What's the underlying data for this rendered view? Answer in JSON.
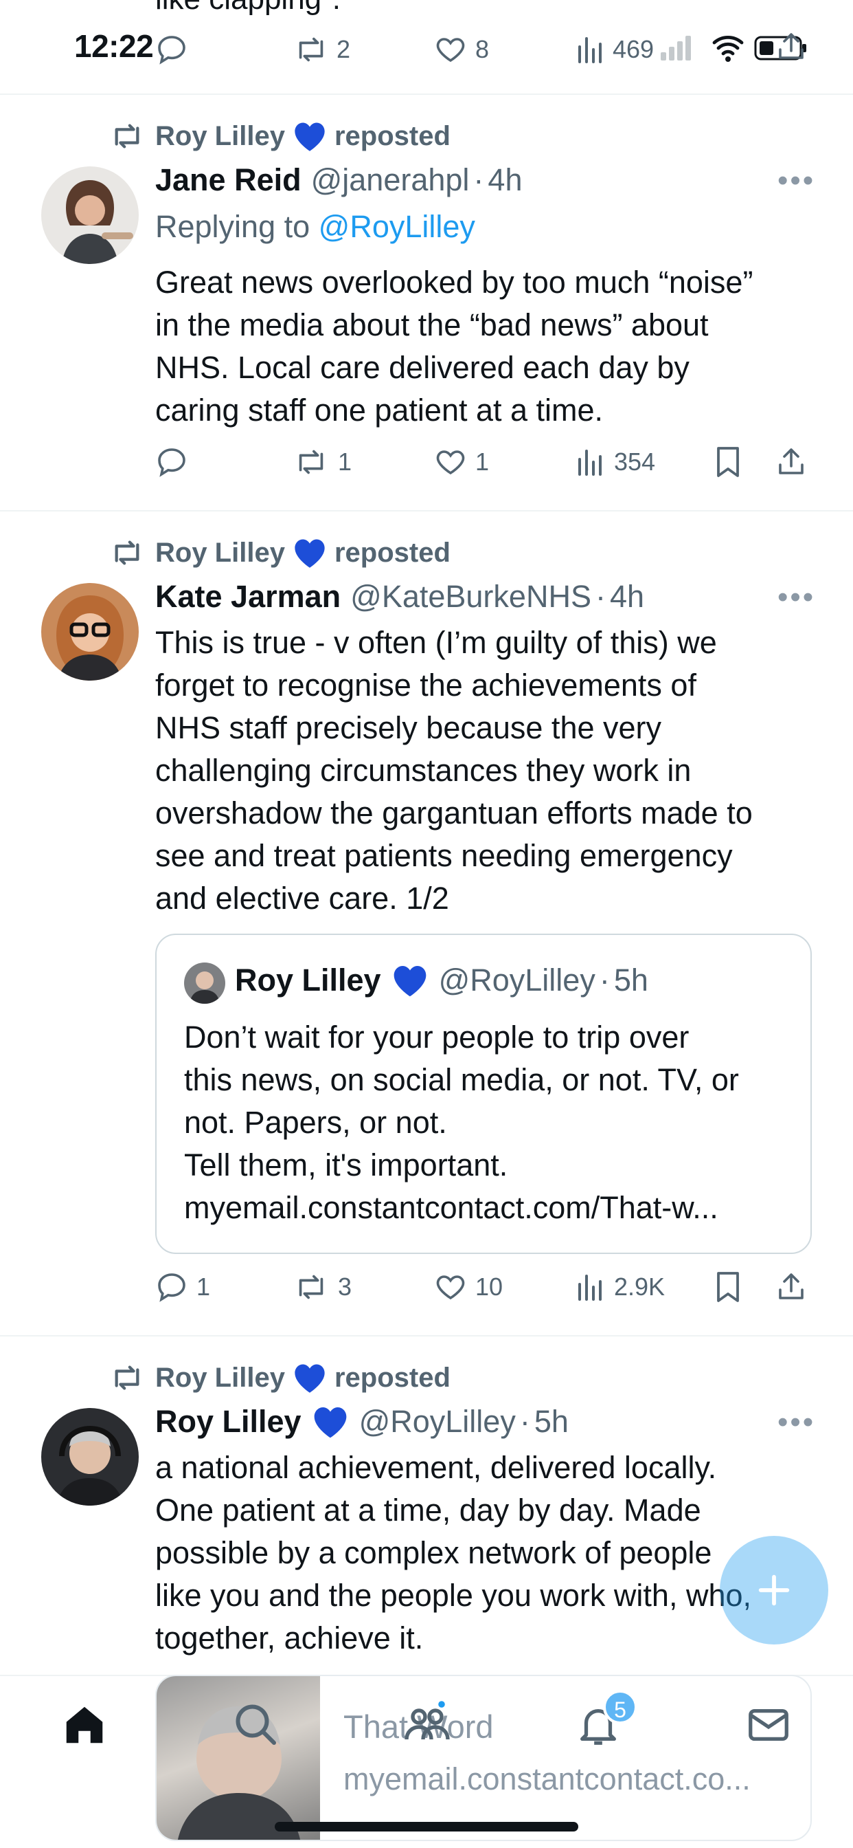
{
  "status_bar": {
    "time": "12:22",
    "cutoff_text": "like clapping\"."
  },
  "top_partial_actions": {
    "reposts": "2",
    "likes": "8",
    "views": "469"
  },
  "colors": {
    "accent": "#1d9bf0",
    "muted": "#536471",
    "heart": "#1d4ed8"
  },
  "feed": [
    {
      "reposted_by": "Roy Lilley",
      "reposted_label": "reposted",
      "name": "Jane Reid",
      "handle": "@janerahpl",
      "time": "4h",
      "replying_prefix": "Replying to",
      "replying_to": "@RoyLilley",
      "lines": [
        "Great news overlooked by too much “noise”",
        "in the media about the “bad news” about",
        "NHS. Local care delivered each day by",
        "caring staff one patient at a time."
      ],
      "replies": "",
      "reposts": "1",
      "likes": "1",
      "views": "354"
    },
    {
      "reposted_by": "Roy Lilley",
      "reposted_label": "reposted",
      "name": "Kate Jarman",
      "handle": "@KateBurkeNHS",
      "time": "4h",
      "lines": [
        "This is true - v often (I’m guilty of this) we",
        "forget to recognise the achievements of",
        "NHS staff precisely because the very",
        "challenging circumstances they work in",
        "overshadow the gargantuan efforts made to",
        "see and treat patients needing emergency",
        "and elective care. 1/2"
      ],
      "quote": {
        "name": "Roy Lilley",
        "handle": "@RoyLilley",
        "time": "5h",
        "lines": [
          "Don’t wait for your people to trip over",
          "this news, on social media, or not. TV, or",
          "not. Papers, or not.",
          "Tell them, it's important.",
          "myemail.constantcontact.com/That-w..."
        ]
      },
      "replies": "1",
      "reposts": "3",
      "likes": "10",
      "views": "2.9K"
    },
    {
      "reposted_by": "Roy Lilley",
      "reposted_label": "reposted",
      "name": "Roy Lilley",
      "handle": "@RoyLilley",
      "time": "5h",
      "lines": [
        "a national achievement, delivered locally.",
        "One patient at a time, day by day. Made",
        "possible by a complex network of people",
        "like you and the people you work with, who,",
        "together, achieve it."
      ]
    }
  ],
  "mini_player": {
    "title": "That Word",
    "url": "myemail.constantcontact.co..."
  },
  "bottom_nav": {
    "notifications_badge": "5"
  },
  "icons": [
    "reply-icon",
    "repost-icon",
    "like-icon",
    "views-icon",
    "bookmark-icon",
    "share-icon",
    "more-icon",
    "home-icon",
    "search-icon",
    "communities-icon",
    "notifications-icon",
    "messages-icon",
    "compose-icon",
    "signal-icon",
    "wifi-icon",
    "battery-icon"
  ]
}
